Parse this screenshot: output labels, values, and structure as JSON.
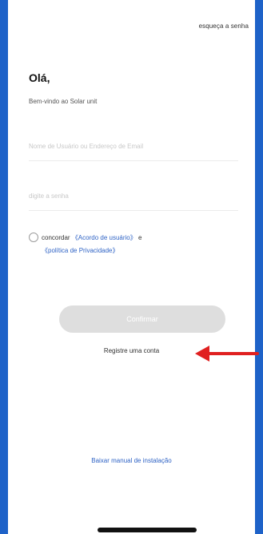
{
  "header": {
    "forgot_password": "esqueça a senha"
  },
  "main": {
    "greeting": "Olá,",
    "welcome": "Bem-vindo ao Solar unit",
    "username_placeholder": "Nome de Usuário ou Endereço de Email",
    "password_placeholder": "digite a senha",
    "agree_prefix": "concordar",
    "user_agreement": "《Acordo de usuário》",
    "and": "e",
    "privacy_policy": "《política de Privacidade》",
    "confirm_label": "Confirmar",
    "register_link": "Registre uma conta",
    "manual_link": "Baixar manual de instalação"
  },
  "colors": {
    "frame": "#1e62c8",
    "link": "#2f63c5",
    "arrow": "#e02020",
    "button_disabled": "#dedede"
  },
  "icons": {
    "annotation": "red-arrow-icon",
    "checkbox": "radio-circle-icon"
  }
}
